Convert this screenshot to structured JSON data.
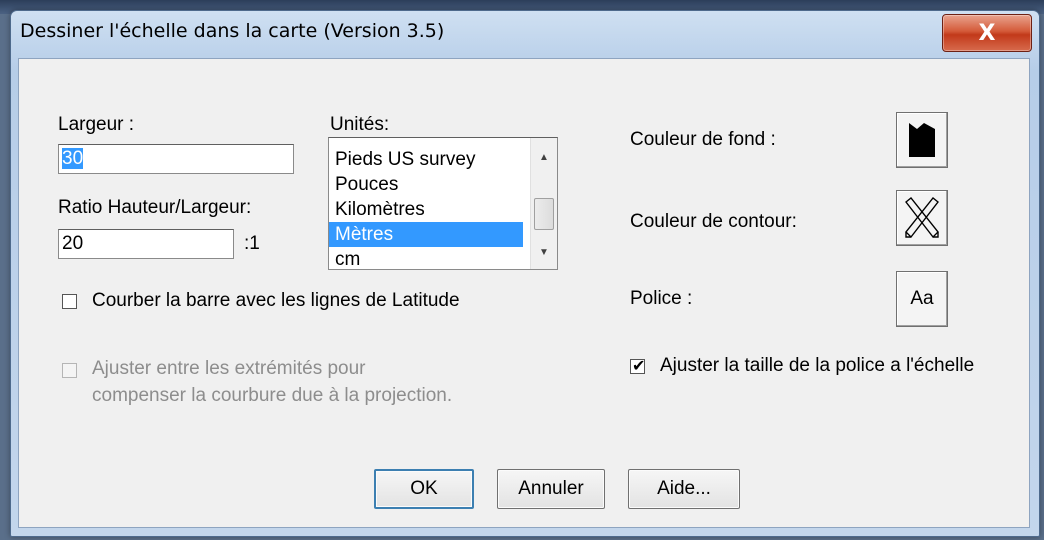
{
  "window": {
    "title": "Dessiner l'échelle dans la carte (Version 3.5)",
    "close_glyph": "X"
  },
  "largeur": {
    "label": "Largeur :",
    "value": "30"
  },
  "ratio": {
    "label": "Ratio Hauteur/Largeur:",
    "value": "20",
    "suffix": ":1"
  },
  "units": {
    "label": "Unités:",
    "items": [
      "Pieds US survey",
      "Pouces",
      "Kilomètres",
      "Mètres",
      "cm"
    ],
    "selected": "Mètres"
  },
  "options": {
    "curve_label": "Courber la barre avec les lignes de Latitude",
    "curve_checked": false,
    "adjust_ends_line1": "Ajuster entre les extrémités pour",
    "adjust_ends_line2": "compenser la courbure due à la projection.",
    "adjust_ends_checked": false,
    "adjust_ends_enabled": false
  },
  "colors": {
    "background_label": "Couleur de fond :",
    "background_icon": "black-fill-swatch-icon",
    "outline_label": "Couleur de contour:",
    "outline_icon": "no-color-cross-icon"
  },
  "font": {
    "label": "Police :",
    "button_label": "Aa",
    "scale_font_label": "Ajuster la taille de la police a l'échelle",
    "scale_font_checked": true
  },
  "buttons": {
    "ok": "OK",
    "cancel": "Annuler",
    "help": "Aide..."
  }
}
